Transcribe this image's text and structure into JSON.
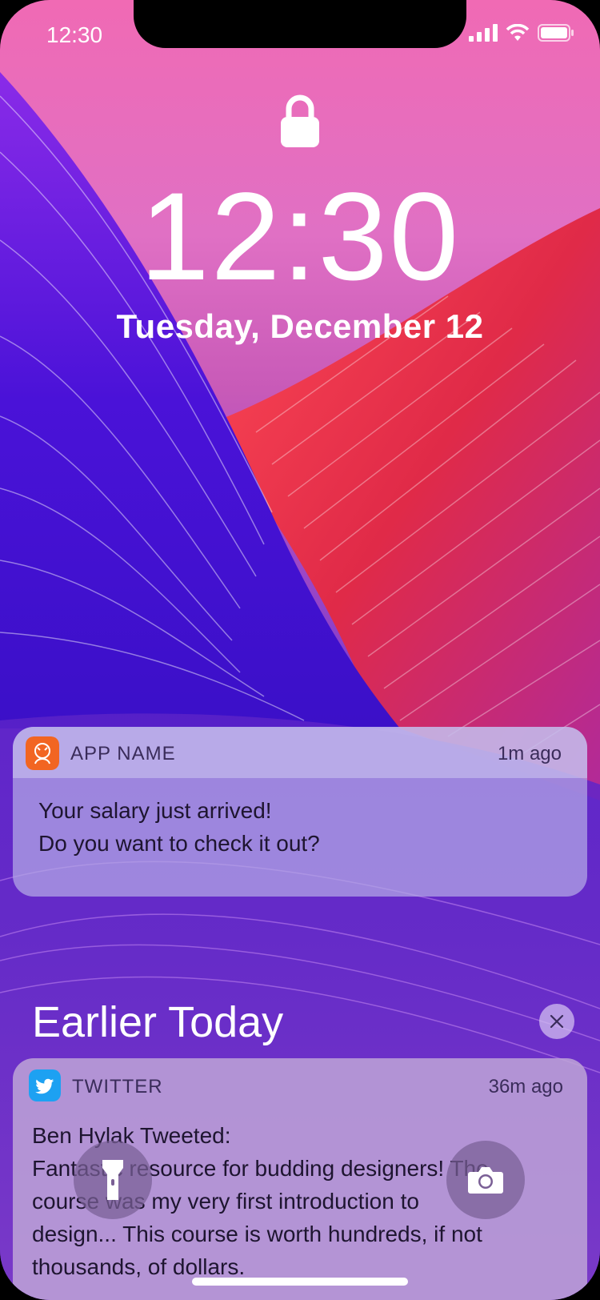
{
  "status": {
    "time": "12:30"
  },
  "lockscreen": {
    "time": "12:30",
    "date": "Tuesday, December 12"
  },
  "notification1": {
    "app_name": "APP NAME",
    "time": "1m ago",
    "line1": "Your salary just arrived!",
    "line2": "Do you want to check it out?"
  },
  "earlier": {
    "title": "Earlier Today"
  },
  "notification2": {
    "app_name": "TWITTER",
    "time": "36m ago",
    "line1": "Ben Hylak Tweeted:",
    "line2": "Fantastic resource for budding designers! The",
    "line3": "course was my very first introduction to",
    "line4": "design... This course is worth hundreds, if not",
    "line5": "thousands, of dollars."
  },
  "icons": {
    "lock": "lock-icon",
    "signal": "cellular-signal-icon",
    "wifi": "wifi-icon",
    "battery": "battery-icon",
    "app": "app-logo-icon",
    "twitter": "twitter-bird-icon",
    "close": "close-icon",
    "flashlight": "flashlight-icon",
    "camera": "camera-icon"
  },
  "colors": {
    "wallpaper_top": "#f06ab4",
    "wallpaper_red": "#e83a4a",
    "wallpaper_blue": "#3a14d0",
    "app_icon": "#f26522",
    "twitter_blue": "#1da1f2"
  }
}
